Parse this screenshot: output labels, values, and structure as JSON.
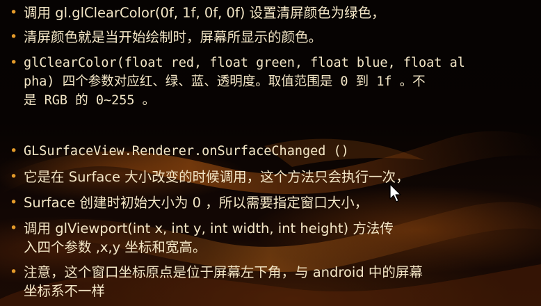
{
  "bullets": [
    {
      "lines": [
        "调用 gl.glClearColor(0f, 1f, 0f, 0f) 设置清屏颜色为绿色，"
      ]
    },
    {
      "lines": [
        "清屏颜色就是当开始绘制时，屏幕所显示的颜色。"
      ]
    },
    {
      "lines": [
        "glClearColor(float red, float green, float blue, float al",
        "pha) 四个参数对应红、绿、蓝、透明度。取值范围是 0 到 1f 。不",
        "是 RGB 的 0~255 。"
      ]
    },
    {
      "lines": [
        "GLSurfaceView.Renderer.onSurfaceChanged ()"
      ]
    },
    {
      "lines": [
        "它是在 Surface 大小改变的时候调用，这个方法只会执行一次，"
      ]
    },
    {
      "lines": [
        "Surface 创建时初始大小为 0 ，所以需要指定窗口大小，"
      ]
    },
    {
      "lines": [
        "调用 glViewport(int x, int y, int width, int height) 方法传",
        "入四个参数 ,x,y 坐标和宽高。"
      ]
    },
    {
      "lines": [
        "注意，这个窗口坐标原点是位于屏幕左下角，与 android 中的屏幕",
        "坐标系不一样"
      ]
    }
  ],
  "colors": {
    "text": "#f3e6c6",
    "bullet": "#e39a2a",
    "background": "#050201"
  },
  "icons": {
    "bullet": "bullet-dot-icon",
    "pointer": "mouse-pointer-icon"
  }
}
